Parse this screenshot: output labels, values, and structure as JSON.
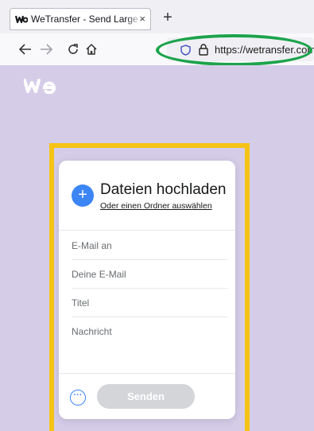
{
  "browser": {
    "tab_title": "WeTransfer - Send Large Files & Share Photos Online",
    "tab_close": "×",
    "new_tab": "+",
    "url": "https://wetransfer.com",
    "icons": {
      "favicon": "wetransfer-favicon-icon",
      "back": "back-arrow-icon",
      "forward": "forward-arrow-icon",
      "reload": "reload-icon",
      "home": "home-icon",
      "tracking": "shield-icon",
      "security": "lock-icon"
    }
  },
  "page": {
    "logo": "wetransfer-logo",
    "background": "#d5cde8"
  },
  "upload_card": {
    "add_icon": "+",
    "title": "Dateien hochladen",
    "folder_link": "Oder einen Ordner auswählen",
    "fields": {
      "email_to": "E-Mail an",
      "your_email": "Deine E-Mail",
      "title": "Titel",
      "message": "Nachricht"
    },
    "more_icon": "···",
    "send_label": "Senden"
  },
  "colors": {
    "accent": "#3b85f5",
    "url_highlight": "#1ca34b",
    "card_highlight": "#f5c316",
    "send_disabled": "#d4d5d9"
  }
}
